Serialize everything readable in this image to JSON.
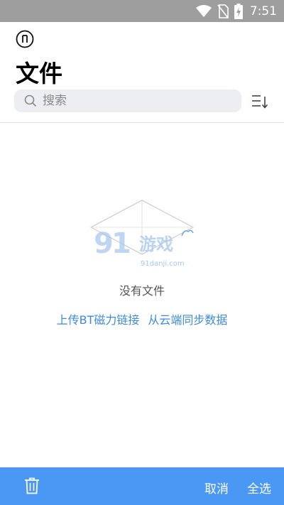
{
  "status_bar": {
    "time": "7:51",
    "icons": [
      "wifi-icon",
      "no-sim-icon",
      "battery-charging-icon"
    ]
  },
  "header": {
    "app_icon": "music-note-circle-icon",
    "title": "文件"
  },
  "search": {
    "placeholder": "搜索",
    "value": ""
  },
  "toolbar": {
    "sort_icon": "sort-icon"
  },
  "empty_state": {
    "illustration": "empty-box-icon",
    "watermark": "91游戏 91danji.com",
    "message": "没有文件",
    "link_upload": "上传BT磁力链接",
    "link_sync": "从云端同步数据"
  },
  "bottom_bar": {
    "background": "#4a98f3",
    "delete_icon": "trash-icon",
    "cancel_label": "取消",
    "select_all_label": "全选"
  },
  "colors": {
    "status_bar": "#9e9e9e",
    "accent_link": "#3d8bde",
    "search_bg": "#eceef2"
  }
}
